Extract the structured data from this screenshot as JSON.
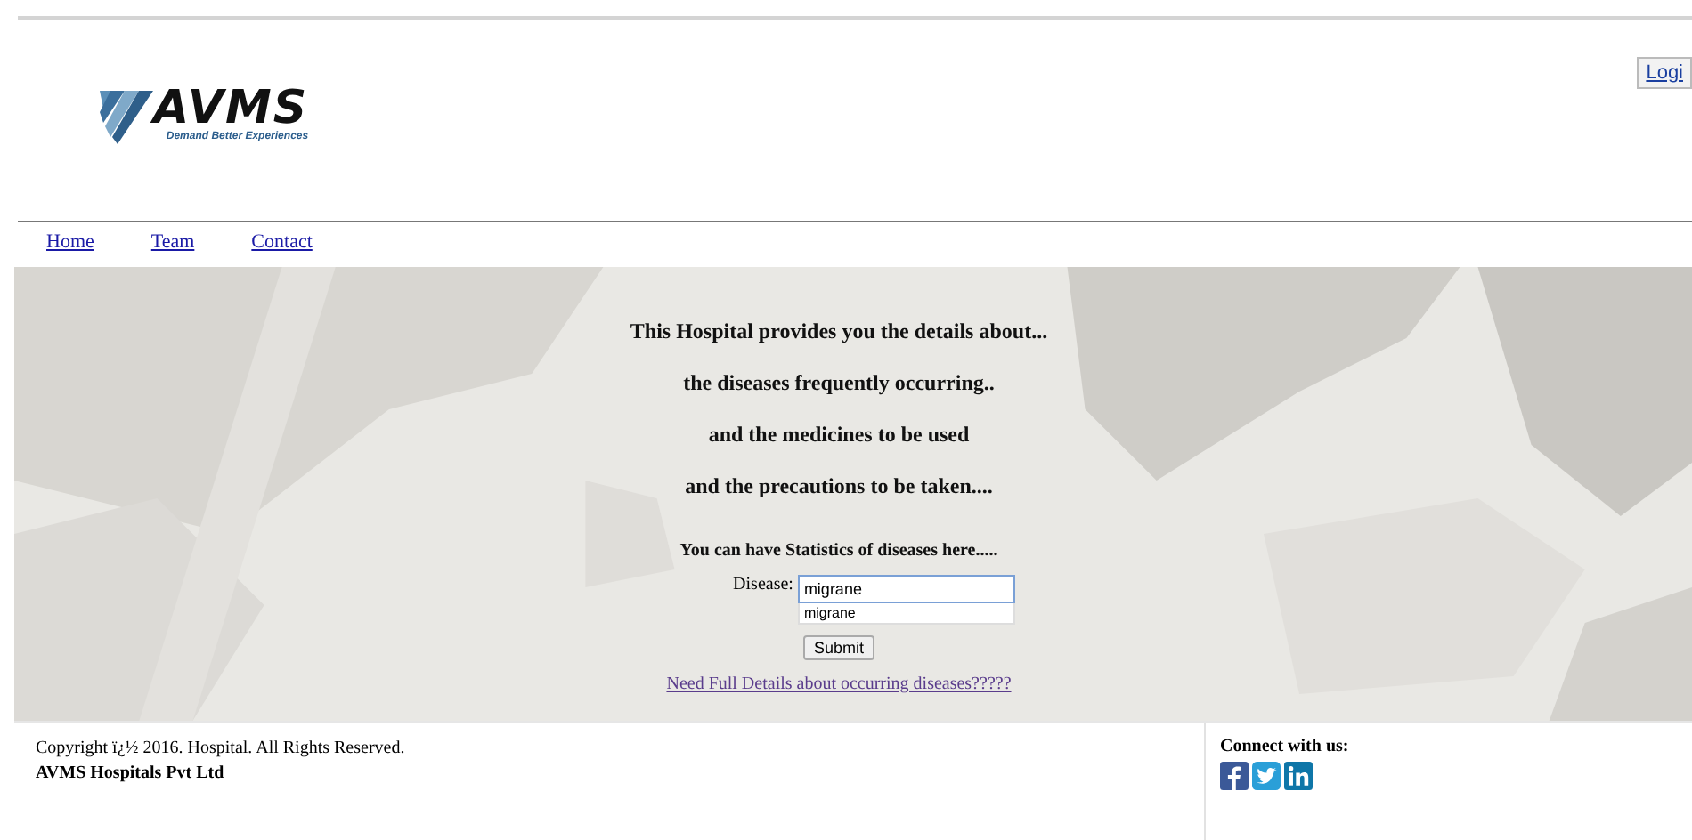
{
  "header": {
    "login_button": "Logi",
    "logo": {
      "name": "AVMS",
      "tagline": "Demand Better Experiences"
    }
  },
  "nav": [
    {
      "label": "Home"
    },
    {
      "label": "Team"
    },
    {
      "label": "Contact"
    }
  ],
  "banner": {
    "kind": "picture",
    "lines": [
      "This Hospital provides you the details about...",
      "the diseases frequently occurring..",
      "and the medicines to be used",
      "and the precautions to be taken...."
    ],
    "stats_heading": "You can have Statistics of diseases here.....",
    "disease_label": "Disease:",
    "disease_value": "migrane",
    "suggestions": [
      "migrane"
    ],
    "submit": "Submit",
    "details_link": "Need Full Details about occurring diseases?????"
  },
  "footer": {
    "copyright": "Copyright ï¿½ 2016. Hospital. All Rights Reserved.",
    "company": "AVMS Hospitals Pvt Ltd",
    "connect": "Connect with us:",
    "social": [
      {
        "kind": "facebook"
      },
      {
        "kind": "twitter"
      },
      {
        "kind": "linkedin"
      }
    ]
  }
}
